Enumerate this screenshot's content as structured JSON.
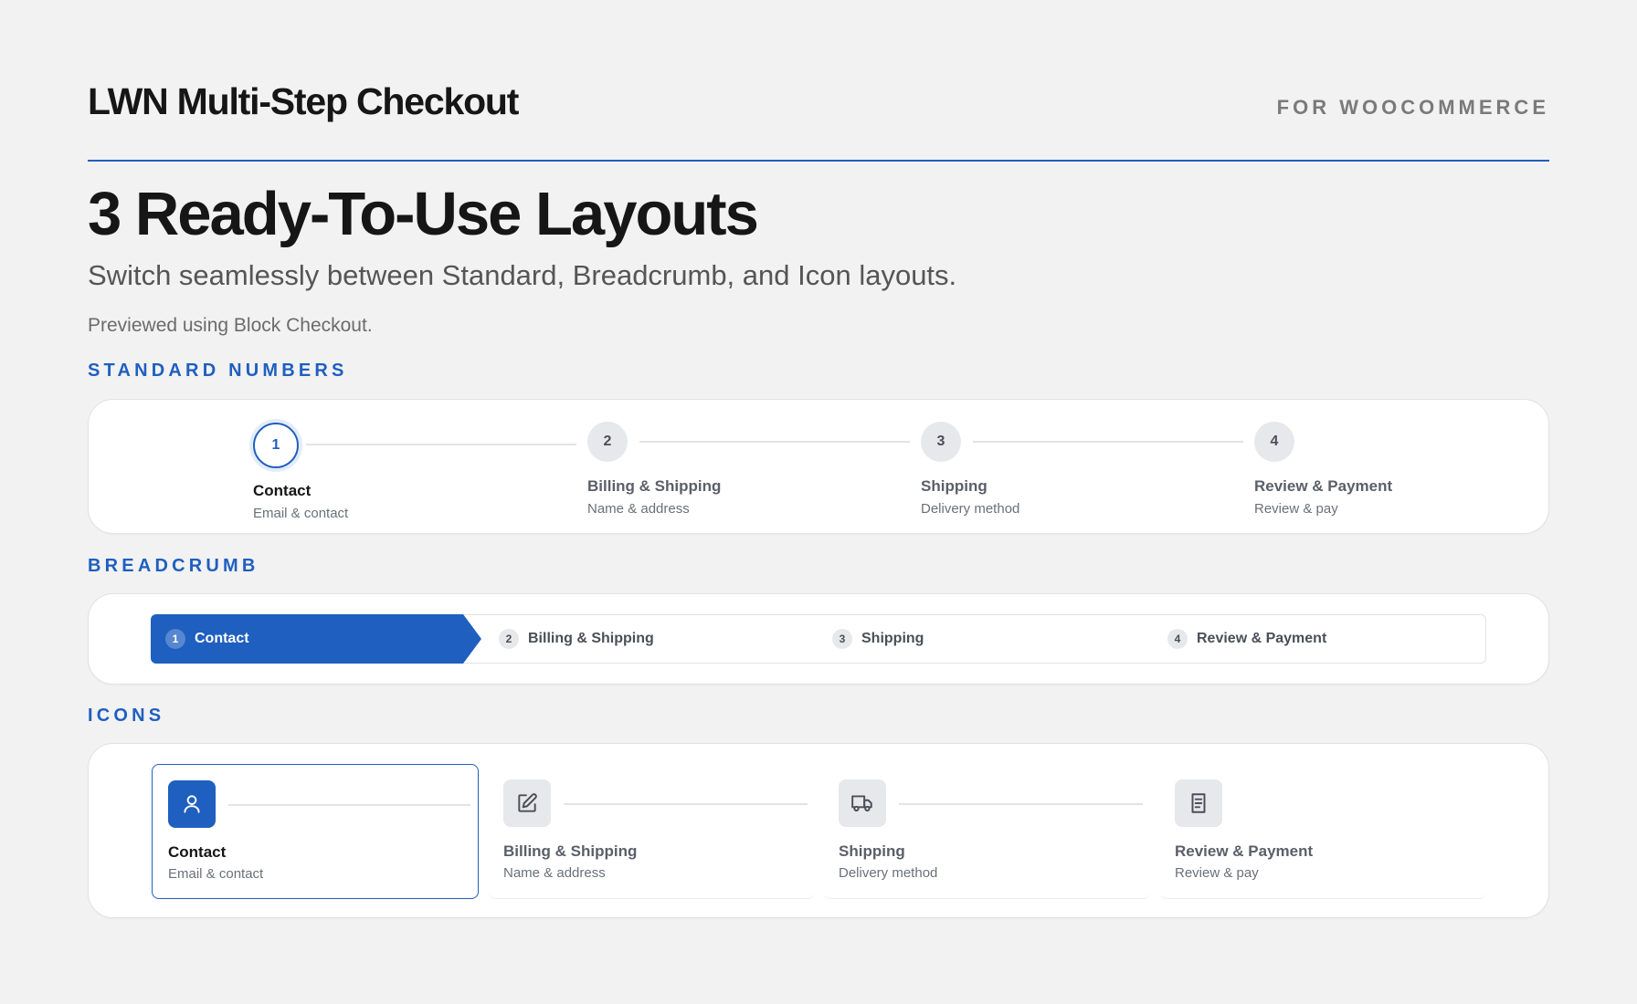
{
  "header": {
    "brand_title": "LWN Multi-Step Checkout",
    "brand_tag": "FOR WOOCOMMERCE",
    "headline": "3 Ready-To-Use Layouts",
    "subhead": "Switch seamlessly between Standard, Breadcrumb, and Icon layouts.",
    "note": "Previewed using Block Checkout."
  },
  "colors": {
    "accent": "#1f5fbf",
    "background": "#f2f2f2",
    "card": "#ffffff",
    "inactive_step": "#e6e8eb"
  },
  "sections": {
    "standard": {
      "label": "STANDARD NUMBERS",
      "active_index": 0,
      "steps": [
        {
          "number": "1",
          "name": "Contact",
          "desc": "Email & contact"
        },
        {
          "number": "2",
          "name": "Billing & Shipping",
          "desc": "Name & address"
        },
        {
          "number": "3",
          "name": "Shipping",
          "desc": "Delivery method"
        },
        {
          "number": "4",
          "name": "Review & Payment",
          "desc": "Review & pay"
        }
      ]
    },
    "breadcrumb": {
      "label": "BREADCRUMB",
      "active_index": 0,
      "steps": [
        {
          "number": "1",
          "name": "Contact"
        },
        {
          "number": "2",
          "name": "Billing & Shipping"
        },
        {
          "number": "3",
          "name": "Shipping"
        },
        {
          "number": "4",
          "name": "Review & Payment"
        }
      ]
    },
    "icons": {
      "label": "ICONS",
      "active_index": 0,
      "steps": [
        {
          "icon": "user-icon",
          "name": "Contact",
          "desc": "Email & contact"
        },
        {
          "icon": "edit-icon",
          "name": "Billing & Shipping",
          "desc": "Name & address"
        },
        {
          "icon": "truck-icon",
          "name": "Shipping",
          "desc": "Delivery method"
        },
        {
          "icon": "receipt-icon",
          "name": "Review & Payment",
          "desc": "Review & pay"
        }
      ]
    }
  }
}
